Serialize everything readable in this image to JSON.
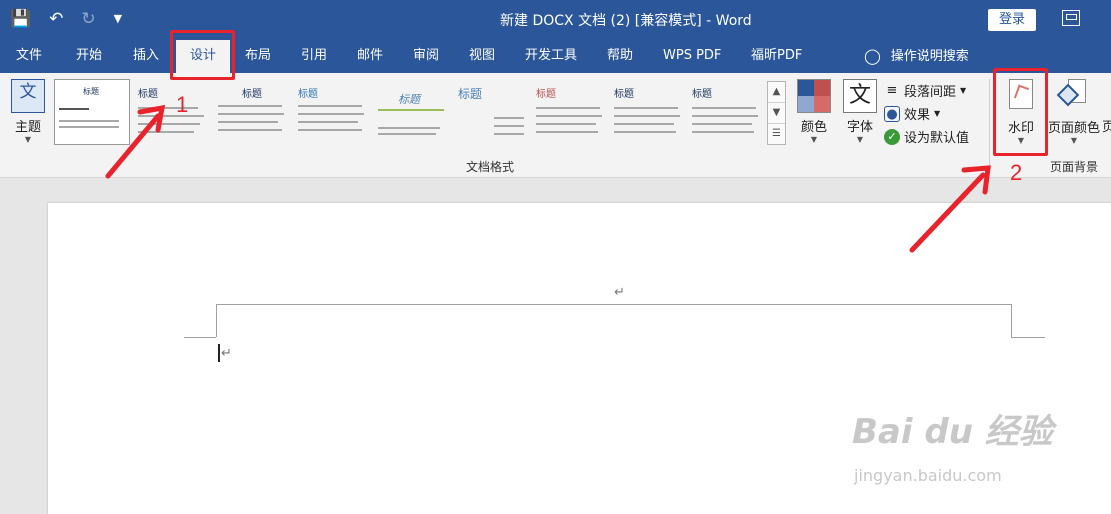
{
  "title_bar": {
    "doc_title": "新建 DOCX 文档 (2) [兼容模式]  -  Word",
    "login_label": "登录"
  },
  "qat": {
    "icons": [
      "save-icon",
      "undo-icon",
      "redo-icon",
      "customize-qat-icon"
    ]
  },
  "tabs": [
    {
      "label": "文件"
    },
    {
      "label": "开始"
    },
    {
      "label": "插入"
    },
    {
      "label": "设计",
      "active": true
    },
    {
      "label": "布局"
    },
    {
      "label": "引用"
    },
    {
      "label": "邮件"
    },
    {
      "label": "审阅"
    },
    {
      "label": "视图"
    },
    {
      "label": "开发工具"
    },
    {
      "label": "帮助"
    },
    {
      "label": "WPS PDF"
    },
    {
      "label": "福昕PDF"
    }
  ],
  "tell_me": {
    "label": "操作说明搜索"
  },
  "ribbon": {
    "theme_label": "主题",
    "style_thumbs": [
      {
        "title": "标题"
      },
      {
        "title": "标题"
      },
      {
        "title": "标题"
      },
      {
        "title": "标题"
      },
      {
        "title": "标题"
      },
      {
        "title": "标题"
      },
      {
        "title": "标题"
      },
      {
        "title": "标题"
      },
      {
        "title": "标题"
      }
    ],
    "document_formatting_label": "文档格式",
    "colors_label": "颜色",
    "fonts_label": "字体",
    "paragraph_spacing_label": "段落间距",
    "effects_label": "效果",
    "set_default_label": "设为默认值",
    "watermark_label": "水印",
    "page_color_label": "页面颜色",
    "page_border_label": "页",
    "page_background_label": "页面背景"
  },
  "annotations": {
    "step1": "1",
    "step2": "2"
  },
  "watermark": {
    "text": "Bai du 经验",
    "url": "jingyan.baidu.com"
  },
  "colors": {
    "accent": "#2b579a",
    "highlight": "#e8232b",
    "theme_swatches": [
      "#2b579a",
      "#c0504d",
      "#8fa8cf",
      "#d56a67"
    ]
  }
}
